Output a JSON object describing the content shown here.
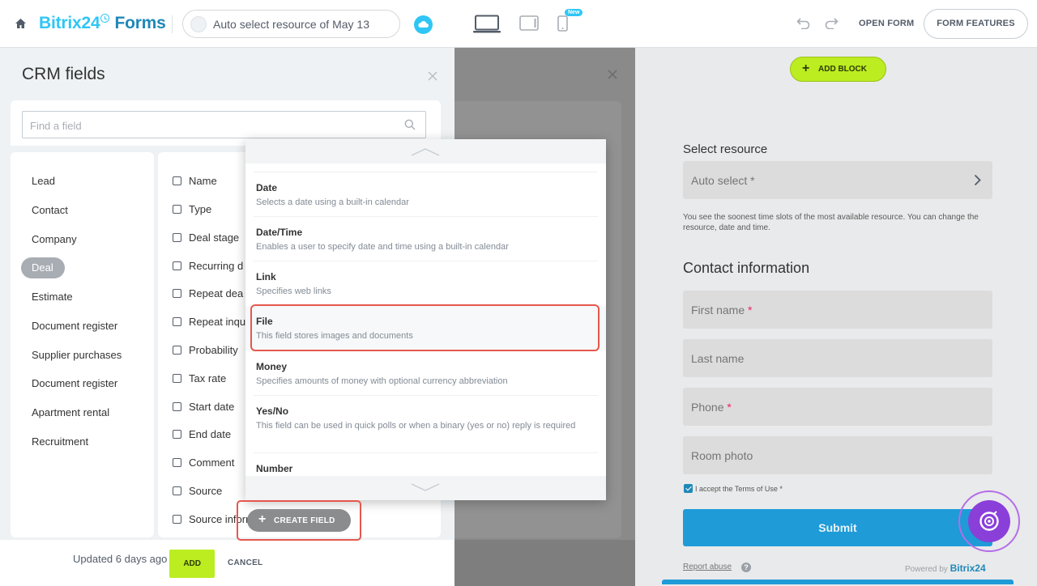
{
  "topbar": {
    "brand_name": "Bitrix24",
    "brand_product": "Forms",
    "form_title": "Auto select resource of May 13",
    "new_badge": "New",
    "open_form": "OPEN FORM",
    "form_features": "FORM FEATURES"
  },
  "crm_panel": {
    "title": "CRM fields",
    "search_placeholder": "Find a field",
    "categories": [
      "Lead",
      "Contact",
      "Company",
      "Deal",
      "Estimate",
      "Document register",
      "Supplier purchases",
      "Document register",
      "Apartment rental",
      "Recruitment"
    ],
    "active_category": "Deal",
    "fields": [
      "Name",
      "Type",
      "Deal stage",
      "Recurring d",
      "Repeat dea",
      "Repeat inqu",
      "Probability",
      "Tax rate",
      "Start date",
      "End date",
      "Comment",
      "Source",
      "Source information"
    ],
    "add_label": "ADD",
    "cancel_label": "CANCEL",
    "updated_text": "Updated 6 days ago"
  },
  "field_types": [
    {
      "title": "Date",
      "description": "Selects a date using a built-in calendar"
    },
    {
      "title": "Date/Time",
      "description": "Enables a user to specify date and time using a built-in calendar"
    },
    {
      "title": "Link",
      "description": "Specifies web links"
    },
    {
      "title": "File",
      "description": "This field stores images and documents"
    },
    {
      "title": "Money",
      "description": "Specifies amounts of money with optional currency abbreviation"
    },
    {
      "title": "Yes/No",
      "description": "This field can be used in quick polls or when a binary (yes or no) reply is required"
    },
    {
      "title": "Number",
      "description": ""
    }
  ],
  "create_field_label": "CREATE FIELD",
  "form_preview": {
    "add_block": "ADD BLOCK",
    "select_resource_title": "Select resource",
    "select_resource_value": "Auto select *",
    "hint": "You see the soonest time slots of the most available resource. You can change the resource, date and time.",
    "contact_title": "Contact information",
    "fields": [
      {
        "label": "First name",
        "required": "*"
      },
      {
        "label": "Last name",
        "required": ""
      },
      {
        "label": "Phone",
        "required": "*"
      },
      {
        "label": "Room photo",
        "required": ""
      }
    ],
    "terms": "I accept the Terms of Use *",
    "submit": "Submit",
    "report_abuse": "Report abuse",
    "help_glyph": "?",
    "powered_by": "Powered by",
    "powered_brand": "Bitrix24"
  },
  "colors": {
    "accent_blue": "#2fc6f6",
    "brand_dark_blue": "#1f88b8",
    "add_green": "#bbed21",
    "highlight_red": "#e5584d",
    "widget_purple": "#8a3fd9",
    "submit_blue": "#1f9bd7"
  }
}
